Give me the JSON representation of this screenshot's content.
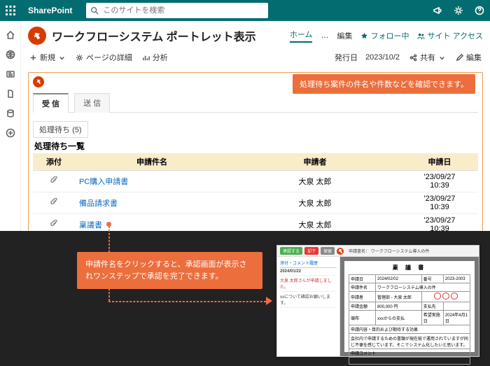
{
  "top": {
    "brand": "SharePoint",
    "search_placeholder": "このサイトを検索"
  },
  "page": {
    "title": "ワークフローシステム ポートレット表示",
    "tabs": {
      "home": "ホーム",
      "more": "…",
      "edit": "編集"
    },
    "follow": "フォロー中",
    "siteaccess": "サイト アクセス"
  },
  "cmd": {
    "new": "新規",
    "details": "ページの詳細",
    "analytics": "分析",
    "pubdate_label": "発行日",
    "pubdate": "2023/10/2",
    "share": "共有",
    "edit": "編集"
  },
  "portlet": {
    "tab_inbox": "受 信",
    "tab_outbox": "送 信",
    "callout_top": "処理待ち案件の件名や件数などを確認できます。",
    "pending_label": "処理待ち",
    "pending_count": "(5)",
    "list_title": "処理待ち一覧",
    "cols": {
      "attach": "添付",
      "name": "申請件名",
      "applicant": "申請者",
      "date": "申請日"
    },
    "rows": [
      {
        "name": "PC購入申請書",
        "applicant": "大泉 太郎",
        "date": "'23/09/27 10:39"
      },
      {
        "name": "備品請求書",
        "applicant": "大泉 太郎",
        "date": "'23/09/27 10:39"
      },
      {
        "name": "稟議書",
        "applicant": "大泉 太郎",
        "date": "'23/09/27 10:39"
      }
    ]
  },
  "callout_bottom": "申請件名をクリックすると、承認画面が表示されワンステップで承認を完了できます。",
  "preview": {
    "btn_approve": "承認する",
    "btn_reject": "却下",
    "btn_hold": "保留",
    "header": "申請書名： ワークフローシステム導入の件",
    "side_title": "添付・コメント履歴",
    "side_date": "2024/01/22",
    "side_line1": "大泉 太郎さんが申請しました。",
    "side_line2": "xxについて確認お願いします。",
    "doc_title": "稟 議 書",
    "f_date_l": "申請日",
    "f_date_v": "2024/02/02",
    "f_no_l": "番号",
    "f_no_v": "2023-2003",
    "f_subj_l": "申請件名",
    "f_subj_v": "ワークフローシステム導入の件",
    "f_app_l": "申請者",
    "f_app_v": "管理部 - 大泉 太郎",
    "f_amt_l": "申請金額",
    "f_amt_v": "800,000 円",
    "f_pay_l": "支払先",
    "f_due_l": "頒布",
    "f_due_v": "xxxからの支払",
    "f_exp_l": "希望実施日",
    "f_exp_v": "2024年4月1日",
    "f_reason_l": "申請内容・目的および期待する効果",
    "f_reason_v": "会社内で申請するための書類が現在紙で運用されていますが同じ不便を感じています。そこでシステム化したいと思います。",
    "f_comment_l": "申請コメント"
  }
}
